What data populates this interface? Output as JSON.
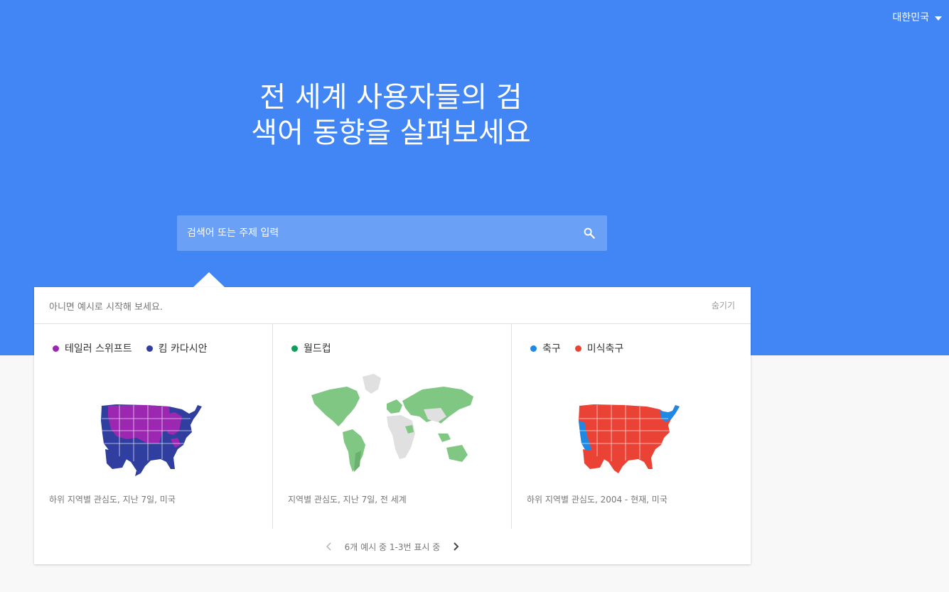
{
  "header": {
    "region": "대한민국"
  },
  "hero": {
    "title": "전 세계 사용자들의 검색어 동향을 살펴보세요"
  },
  "search": {
    "placeholder": "검색어 또는 주제 입력"
  },
  "examples": {
    "intro": "아니면 예시로 시작해 보세요.",
    "hide_label": "숨기기",
    "cards": [
      {
        "terms": [
          {
            "label": "테일러 스위프트",
            "color": "#9c27b0"
          },
          {
            "label": "킴 카다시안",
            "color": "#303f9f"
          }
        ],
        "caption": "하위 지역별 관심도, 지난 7일, 미국",
        "map": "us"
      },
      {
        "terms": [
          {
            "label": "월드컵",
            "color": "#0f9d58"
          }
        ],
        "caption": "지역별 관심도, 지난 7일, 전 세계",
        "map": "world"
      },
      {
        "terms": [
          {
            "label": "축구",
            "color": "#1e88e5"
          },
          {
            "label": "미식축구",
            "color": "#ea4335"
          }
        ],
        "caption": "하위 지역별 관심도, 2004 - 현재, 미국",
        "map": "us"
      }
    ],
    "pager": "6개 예시 중 1-3번 표시 중"
  }
}
